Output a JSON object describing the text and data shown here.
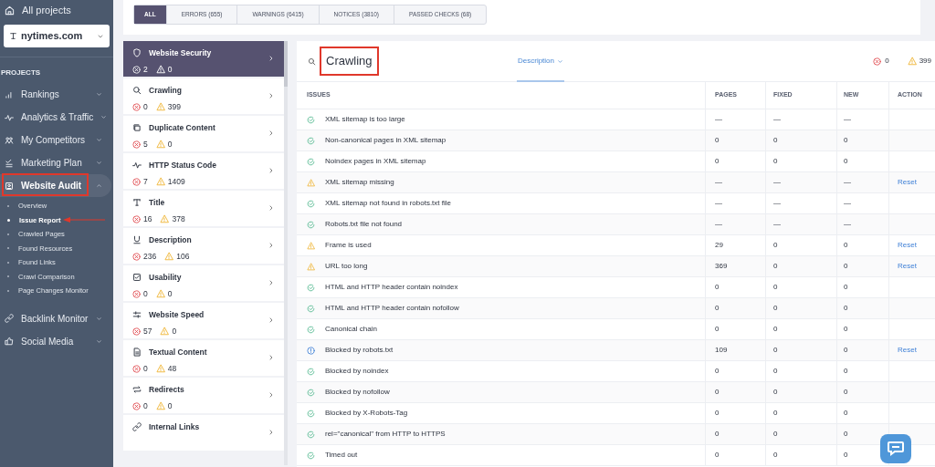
{
  "sidebar": {
    "all_projects": "All projects",
    "project": "nytimes.com",
    "section": "PROJECTS",
    "items": [
      {
        "label": "Rankings",
        "expanded": false,
        "selected": false,
        "highlighted": false
      },
      {
        "label": "Analytics & Traffic",
        "expanded": false,
        "selected": false,
        "highlighted": false
      },
      {
        "label": "My Competitors",
        "expanded": false,
        "selected": false,
        "highlighted": false
      },
      {
        "label": "Marketing Plan",
        "expanded": false,
        "selected": false,
        "highlighted": false
      },
      {
        "label": "Website Audit",
        "expanded": true,
        "selected": true,
        "highlighted": true,
        "children": [
          {
            "label": "Overview",
            "selected": false,
            "pointed": false
          },
          {
            "label": "Issue Report",
            "selected": true,
            "pointed": true
          },
          {
            "label": "Crawled Pages",
            "selected": false,
            "pointed": false
          },
          {
            "label": "Found Resources",
            "selected": false,
            "pointed": false
          },
          {
            "label": "Found Links",
            "selected": false,
            "pointed": false
          },
          {
            "label": "Crawl Comparison",
            "selected": false,
            "pointed": false
          },
          {
            "label": "Page Changes Monitor",
            "selected": false,
            "pointed": false
          }
        ]
      },
      {
        "label": "Backlink Monitor",
        "expanded": false,
        "selected": false,
        "highlighted": false
      },
      {
        "label": "Social Media",
        "expanded": false,
        "selected": false,
        "highlighted": false
      }
    ]
  },
  "filter_tabs": [
    {
      "label": "ALL",
      "selected": true
    },
    {
      "label": "ERRORS (655)",
      "selected": false
    },
    {
      "label": "WARNINGS (6415)",
      "selected": false
    },
    {
      "label": "NOTICES (3810)",
      "selected": false
    },
    {
      "label": "PASSED CHECKS (68)",
      "selected": false
    }
  ],
  "categories": [
    {
      "title": "Website Security",
      "errors": "2",
      "warnings": "0",
      "selected": true
    },
    {
      "title": "Crawling",
      "errors": "0",
      "warnings": "399",
      "selected": false
    },
    {
      "title": "Duplicate Content",
      "errors": "5",
      "warnings": "0",
      "selected": false
    },
    {
      "title": "HTTP Status Code",
      "errors": "7",
      "warnings": "1409",
      "selected": false
    },
    {
      "title": "Title",
      "errors": "16",
      "warnings": "378",
      "selected": false
    },
    {
      "title": "Description",
      "errors": "236",
      "warnings": "106",
      "selected": false
    },
    {
      "title": "Usability",
      "errors": "0",
      "warnings": "0",
      "selected": false
    },
    {
      "title": "Website Speed",
      "errors": "57",
      "warnings": "0",
      "selected": false
    },
    {
      "title": "Textual Content",
      "errors": "0",
      "warnings": "48",
      "selected": false
    },
    {
      "title": "Redirects",
      "errors": "0",
      "warnings": "0",
      "selected": false
    },
    {
      "title": "Internal Links",
      "selected": false
    }
  ],
  "panel": {
    "title": "Crawling",
    "title_highlighted": true,
    "view": "Description",
    "errors": "0",
    "warnings": "399",
    "table": {
      "columns": [
        "ISSUES",
        "PAGES",
        "FIXED",
        "NEW",
        "ACTION"
      ],
      "rows": [
        {
          "kind": "passed",
          "issue": "XML sitemap is too large",
          "pages": "—",
          "fixed": "—",
          "new": "—"
        },
        {
          "kind": "passed",
          "issue": "Non-canonical pages in XML sitemap",
          "pages": "0",
          "fixed": "0",
          "new": "0"
        },
        {
          "kind": "passed",
          "issue": "Noindex pages in XML sitemap",
          "pages": "0",
          "fixed": "0",
          "new": "0"
        },
        {
          "kind": "warning",
          "issue": "XML sitemap missing",
          "pages": "—",
          "fixed": "—",
          "new": "—",
          "action": "Reset"
        },
        {
          "kind": "passed",
          "issue": "XML sitemap not found in robots.txt file",
          "pages": "—",
          "fixed": "—",
          "new": "—"
        },
        {
          "kind": "passed",
          "issue": "Robots.txt file not found",
          "pages": "—",
          "fixed": "—",
          "new": "—"
        },
        {
          "kind": "warning",
          "issue": "Frame is used",
          "pages": "29",
          "fixed": "0",
          "new": "0",
          "action": "Reset"
        },
        {
          "kind": "warning",
          "issue": "URL too long",
          "pages": "369",
          "fixed": "0",
          "new": "0",
          "action": "Reset"
        },
        {
          "kind": "passed",
          "issue": "HTML and HTTP header contain noindex",
          "pages": "0",
          "fixed": "0",
          "new": "0"
        },
        {
          "kind": "passed",
          "issue": "HTML and HTTP header contain nofollow",
          "pages": "0",
          "fixed": "0",
          "new": "0"
        },
        {
          "kind": "passed",
          "issue": "Canonical chain",
          "pages": "0",
          "fixed": "0",
          "new": "0"
        },
        {
          "kind": "notice",
          "issue": "Blocked by robots.txt",
          "pages": "109",
          "fixed": "0",
          "new": "0",
          "action": "Reset"
        },
        {
          "kind": "passed",
          "issue": "Blocked by noindex",
          "pages": "0",
          "fixed": "0",
          "new": "0"
        },
        {
          "kind": "passed",
          "issue": "Blocked by nofollow",
          "pages": "0",
          "fixed": "0",
          "new": "0"
        },
        {
          "kind": "passed",
          "issue": "Blocked by X-Robots-Tag",
          "pages": "0",
          "fixed": "0",
          "new": "0"
        },
        {
          "kind": "passed",
          "issue": "rel=\"canonical\" from HTTP to HTTPS",
          "pages": "0",
          "fixed": "0",
          "new": "0"
        },
        {
          "kind": "passed",
          "issue": "Timed out",
          "pages": "0",
          "fixed": "0",
          "new": "0"
        }
      ]
    }
  }
}
